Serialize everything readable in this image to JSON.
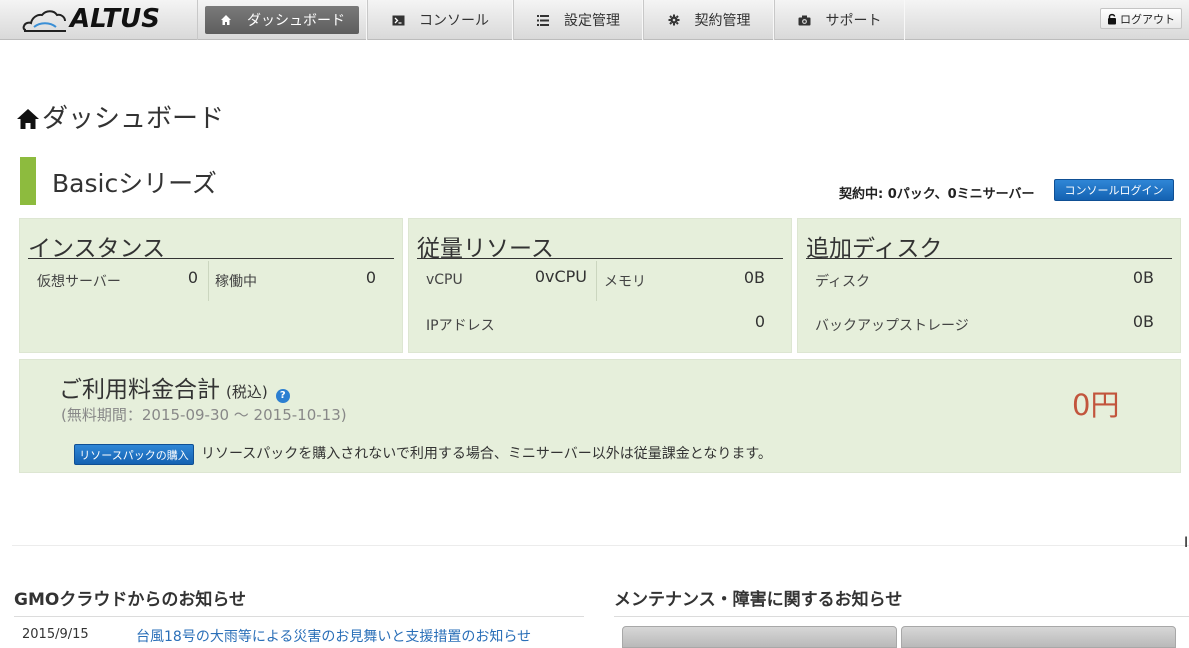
{
  "header": {
    "logo_text": "ALTUS",
    "nav": [
      {
        "label": "ダッシュボード",
        "icon": "home-icon",
        "active": true
      },
      {
        "label": "コンソール",
        "icon": "terminal-icon",
        "active": false
      },
      {
        "label": "設定管理",
        "icon": "list-icon",
        "active": false
      },
      {
        "label": "契約管理",
        "icon": "gear-icon",
        "active": false
      },
      {
        "label": "サポート",
        "icon": "camera-icon",
        "active": false
      }
    ],
    "logout_label": "ログアウト"
  },
  "page": {
    "title": "ダッシュボード",
    "series_title": "Basicシリーズ",
    "contract_text": "契約中: 0パック、0ミニサーバー",
    "console_login_label": "コンソールログイン"
  },
  "panels": {
    "instance": {
      "title": "インスタンス",
      "virtual_server_label": "仮想サーバー",
      "virtual_server_value": "0",
      "running_label": "稼働中",
      "running_value": "0"
    },
    "metered": {
      "title": "従量リソース",
      "vcpu_label": "vCPU",
      "vcpu_value": "0vCPU",
      "memory_label": "メモリ",
      "memory_value": "0B",
      "ip_label": "IPアドレス",
      "ip_value": "0"
    },
    "disk": {
      "title": "追加ディスク",
      "disk_label": "ディスク",
      "disk_value": "0B",
      "backup_label": "バックアップストレージ",
      "backup_value": "0B"
    }
  },
  "billing": {
    "title": "ご利用料金合計",
    "tax_note": "(税込)",
    "help_icon": "?",
    "period": "(無料期間：2015-09-30 〜 2015-10-13)",
    "amount": "0円",
    "buy_button_label": "リソースパックの購入",
    "note": "リソースパックを購入されないで利用する場合、ミニサーバー以外は従量課金となります。"
  },
  "news": {
    "title": "GMOクラウドからのお知らせ",
    "items": [
      {
        "date": "2015/9/15",
        "text": "台風18号の大雨等による災害のお見舞いと支援措置のお知らせ"
      }
    ]
  },
  "maintenance": {
    "title": "メンテナンス・障害に関するお知らせ"
  }
}
